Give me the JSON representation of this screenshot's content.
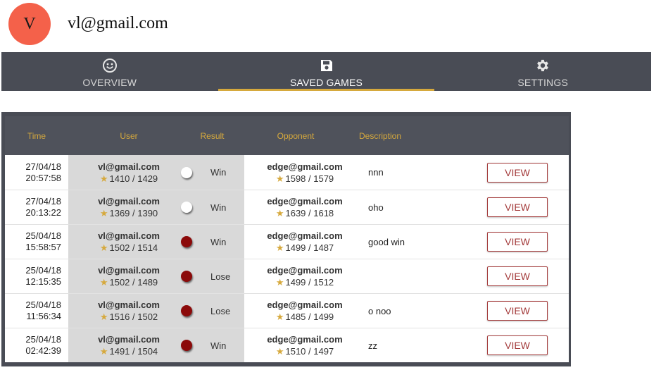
{
  "profile": {
    "initial": "V",
    "email": "vl@gmail.com",
    "avatar_color": "#f4614a"
  },
  "tabs": [
    {
      "label": "OVERVIEW",
      "icon": "smiley-icon",
      "active": false
    },
    {
      "label": "SAVED GAMES",
      "icon": "save-icon",
      "active": true
    },
    {
      "label": "SETTINGS",
      "icon": "gear-icon",
      "active": false
    }
  ],
  "table": {
    "headers": {
      "time": "Time",
      "user": "User",
      "result": "Result",
      "opponent": "Opponent",
      "description": "Description"
    },
    "rows": [
      {
        "date": "27/04/18",
        "time": "20:57:58",
        "user": "vl@gmail.com",
        "user_rating": "1410 / 1429",
        "stone": "white",
        "result": "Win",
        "opponent": "edge@gmail.com",
        "opp_rating": "1598 / 1579",
        "description": "nnn",
        "view": "VIEW"
      },
      {
        "date": "27/04/18",
        "time": "20:13:22",
        "user": "vl@gmail.com",
        "user_rating": "1369 / 1390",
        "stone": "white",
        "result": "Win",
        "opponent": "edge@gmail.com",
        "opp_rating": "1639 / 1618",
        "description": "oho",
        "view": "VIEW"
      },
      {
        "date": "25/04/18",
        "time": "15:58:57",
        "user": "vl@gmail.com",
        "user_rating": "1502 / 1514",
        "stone": "dark",
        "result": "Win",
        "opponent": "edge@gmail.com",
        "opp_rating": "1499 / 1487",
        "description": "good win",
        "view": "VIEW"
      },
      {
        "date": "25/04/18",
        "time": "12:15:35",
        "user": "vl@gmail.com",
        "user_rating": "1502 / 1489",
        "stone": "dark",
        "result": "Lose",
        "opponent": "edge@gmail.com",
        "opp_rating": "1499 / 1512",
        "description": "",
        "view": "VIEW"
      },
      {
        "date": "25/04/18",
        "time": "11:56:34",
        "user": "vl@gmail.com",
        "user_rating": "1516 / 1502",
        "stone": "dark",
        "result": "Lose",
        "opponent": "edge@gmail.com",
        "opp_rating": "1485 / 1499",
        "description": "o noo",
        "view": "VIEW"
      },
      {
        "date": "25/04/18",
        "time": "02:42:39",
        "user": "vl@gmail.com",
        "user_rating": "1491 / 1504",
        "stone": "dark",
        "result": "Win",
        "opponent": "edge@gmail.com",
        "opp_rating": "1510 / 1497",
        "description": "zz",
        "view": "VIEW"
      }
    ]
  },
  "colors": {
    "tabbar": "#494c55",
    "accent": "#d6a93d",
    "view_button": "#a33a3a",
    "dark_stone": "#8b0a0a"
  }
}
